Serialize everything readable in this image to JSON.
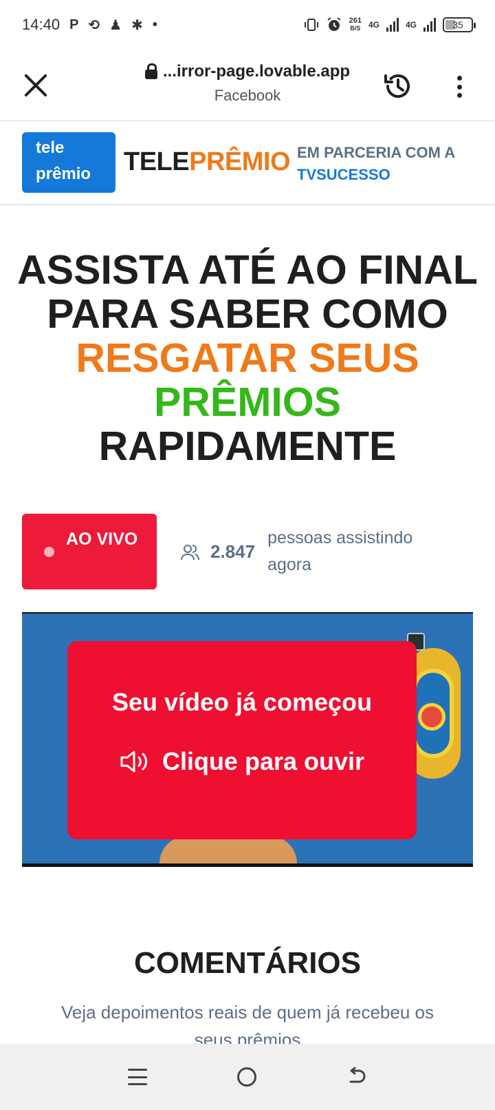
{
  "status_bar": {
    "time": "14:40",
    "notification_icons": [
      "P",
      "⟲",
      "♟",
      "✱",
      "•"
    ],
    "net_speed_value": "261",
    "net_speed_unit": "B/S",
    "signal1": "4G",
    "signal2": "4G",
    "battery": "35"
  },
  "browser": {
    "url": "...irror-page.lovable.app",
    "source": "Facebook"
  },
  "header": {
    "logo_line1": "tele",
    "logo_line2": "prêmio",
    "brand_part1": "TELE",
    "brand_part2": "PRÊMIO",
    "partner_line1": "EM PARCERIA COM A",
    "partner_line2": "TVSUCESSO"
  },
  "headline": {
    "line1": "ASSISTA ATÉ AO FINAL",
    "line2": "PARA SABER COMO",
    "line3": "RESGATAR SEUS",
    "line4": "PRÊMIOS",
    "line5": "RAPIDAMENTE"
  },
  "live": {
    "badge_label": "AO VIVO",
    "viewer_count": "2.847",
    "viewer_label": "pessoas assistindo agora"
  },
  "video": {
    "overlay_title": "Seu vídeo já começou",
    "overlay_cta": "Clique para ouvir"
  },
  "comments": {
    "title": "COMENTÁRIOS",
    "subtitle": "Veja depoimentos reais de quem já recebeu os seus prêmios"
  }
}
